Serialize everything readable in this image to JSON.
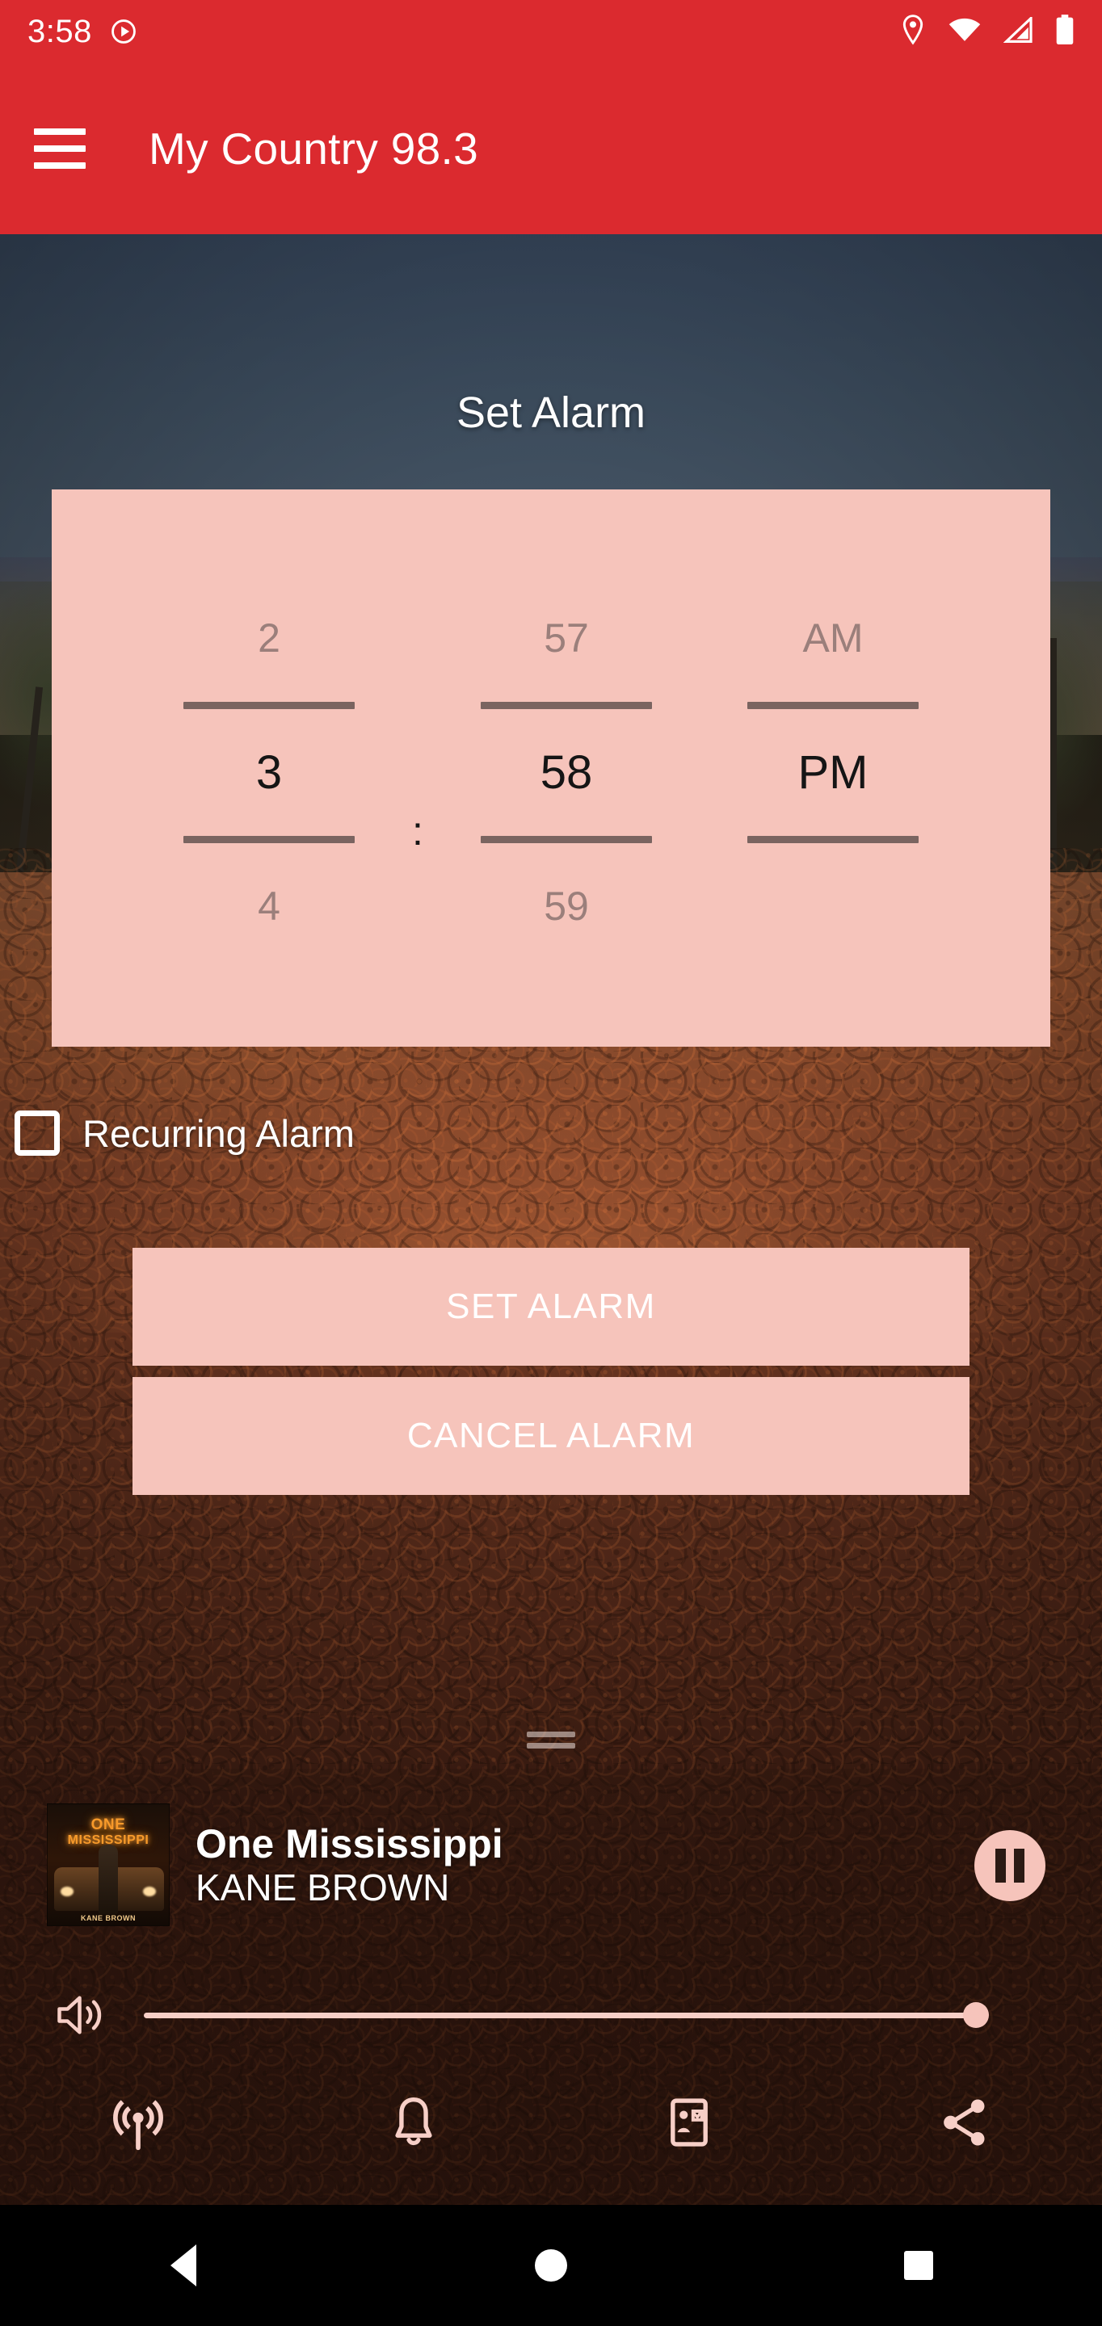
{
  "status_bar": {
    "time": "3:58",
    "icons": [
      "record-icon",
      "location-icon",
      "wifi-icon",
      "cellular-icon",
      "battery-icon"
    ]
  },
  "app_bar": {
    "menu_icon": "hamburger-menu-icon",
    "title": "My Country 98.3"
  },
  "main": {
    "page_title": "Set Alarm",
    "time_picker": {
      "hour": {
        "previous": "2",
        "selected": "3",
        "next": "4"
      },
      "separator": ":",
      "minute": {
        "previous": "57",
        "selected": "58",
        "next": "59"
      },
      "meridiem": {
        "previous": "AM",
        "selected": "PM",
        "next": ""
      }
    },
    "recurring_alarm": {
      "label": "Recurring Alarm",
      "checked": false
    },
    "buttons": {
      "set": "SET ALARM",
      "cancel": "CANCEL ALARM"
    }
  },
  "now_playing": {
    "title": "One Mississippi",
    "artist": "KANE BROWN",
    "album_art": {
      "line1": "ONE",
      "line2": "MISSISSIPPI",
      "credit": "KANE BROWN"
    },
    "transport_icon": "pause-icon",
    "volume": {
      "icon": "volume-up-icon",
      "level": 100
    }
  },
  "bottom_icons": [
    {
      "name": "broadcast-icon"
    },
    {
      "name": "alarm-bell-icon"
    },
    {
      "name": "contact-card-icon"
    },
    {
      "name": "share-icon"
    }
  ],
  "android_nav": {
    "back": "back-icon",
    "home": "home-icon",
    "recents": "recents-icon"
  },
  "colors": {
    "brand_red": "#DB2A2F",
    "panel_pink": "#F6C4BB",
    "rule": "#7A6460",
    "ghost_text": "#9B7F7B"
  }
}
